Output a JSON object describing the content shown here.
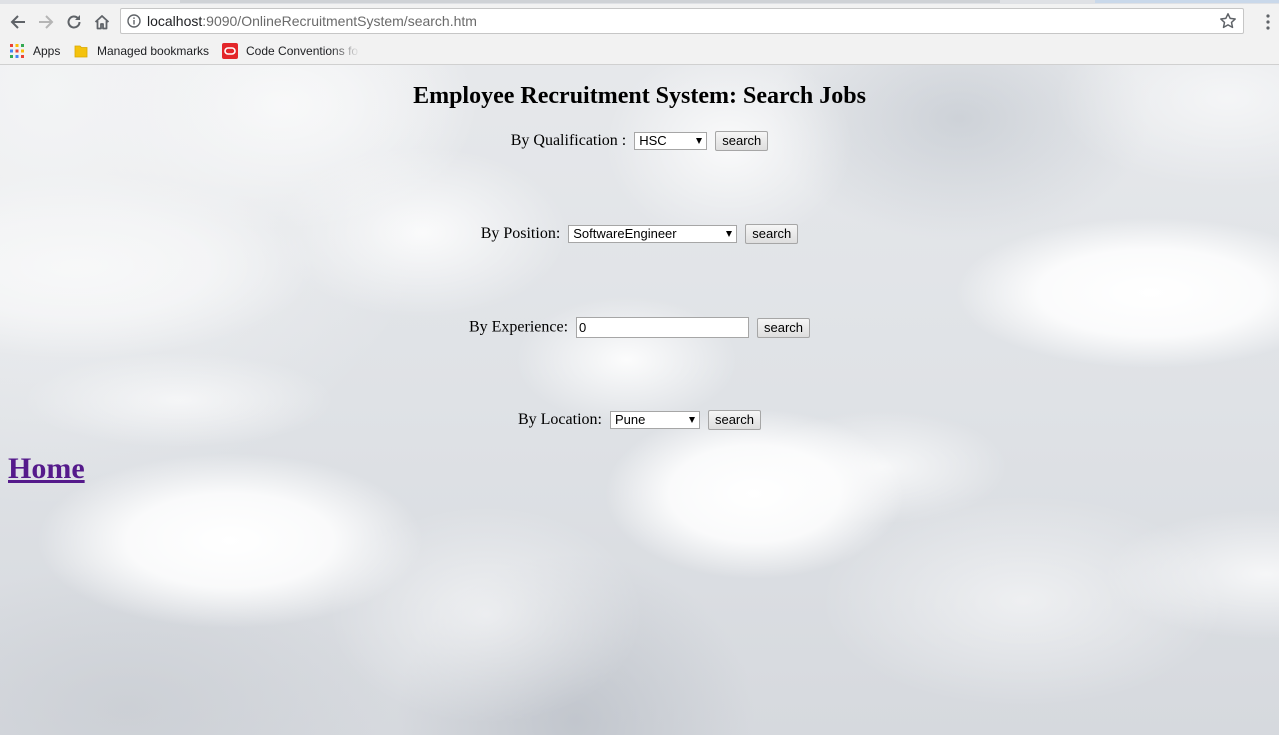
{
  "browser": {
    "url_host": "localhost",
    "url_path": ":9090/OnlineRecruitmentSystem/search.htm",
    "bookmarks": [
      {
        "label": "Apps",
        "icon": "apps-grid-icon"
      },
      {
        "label": "Managed bookmarks",
        "icon": "folder-icon"
      },
      {
        "label": "Code Conventions fo",
        "icon": "oracle-icon"
      }
    ]
  },
  "page": {
    "title": "Employee Recruitment System: Search Jobs",
    "qualification": {
      "label": "By Qualification :",
      "selected": "HSC",
      "button": "search"
    },
    "position": {
      "label": "By Position:",
      "selected": "SoftwareEngineer",
      "button": "search"
    },
    "experience": {
      "label": "By Experience:",
      "value": "0",
      "button": "search"
    },
    "location": {
      "label": "By Location:",
      "selected": "Pune",
      "button": "search"
    },
    "home_link": "Home"
  },
  "colors": {
    "link_visited": "#551a8b",
    "chrome_bg": "#f2f2f2"
  }
}
